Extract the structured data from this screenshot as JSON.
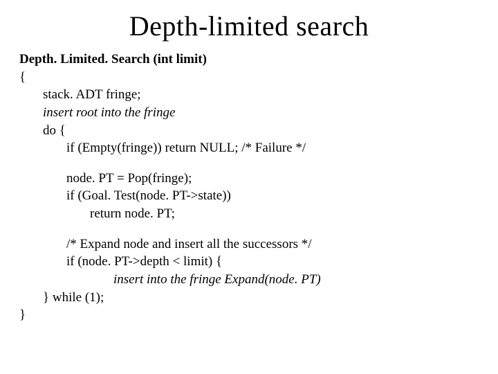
{
  "title": "Depth-limited search",
  "code": {
    "sig": "Depth. Limited. Search (int limit)",
    "open": "{",
    "l1": "stack. ADT fringe;",
    "l2": "insert root into the fringe",
    "l3": "do {",
    "l4": "if (Empty(fringe)) return NULL; /* Failure */",
    "l5": "node. PT = Pop(fringe);",
    "l6": "if (Goal. Test(node. PT->state))",
    "l7": "return node. PT;",
    "l8": "/* Expand node and insert all the successors */",
    "l9": " if (node. PT->depth < limit) {",
    "l10": "insert into the fringe Expand(node. PT)",
    "l11": "} while (1);",
    "close": "}"
  }
}
